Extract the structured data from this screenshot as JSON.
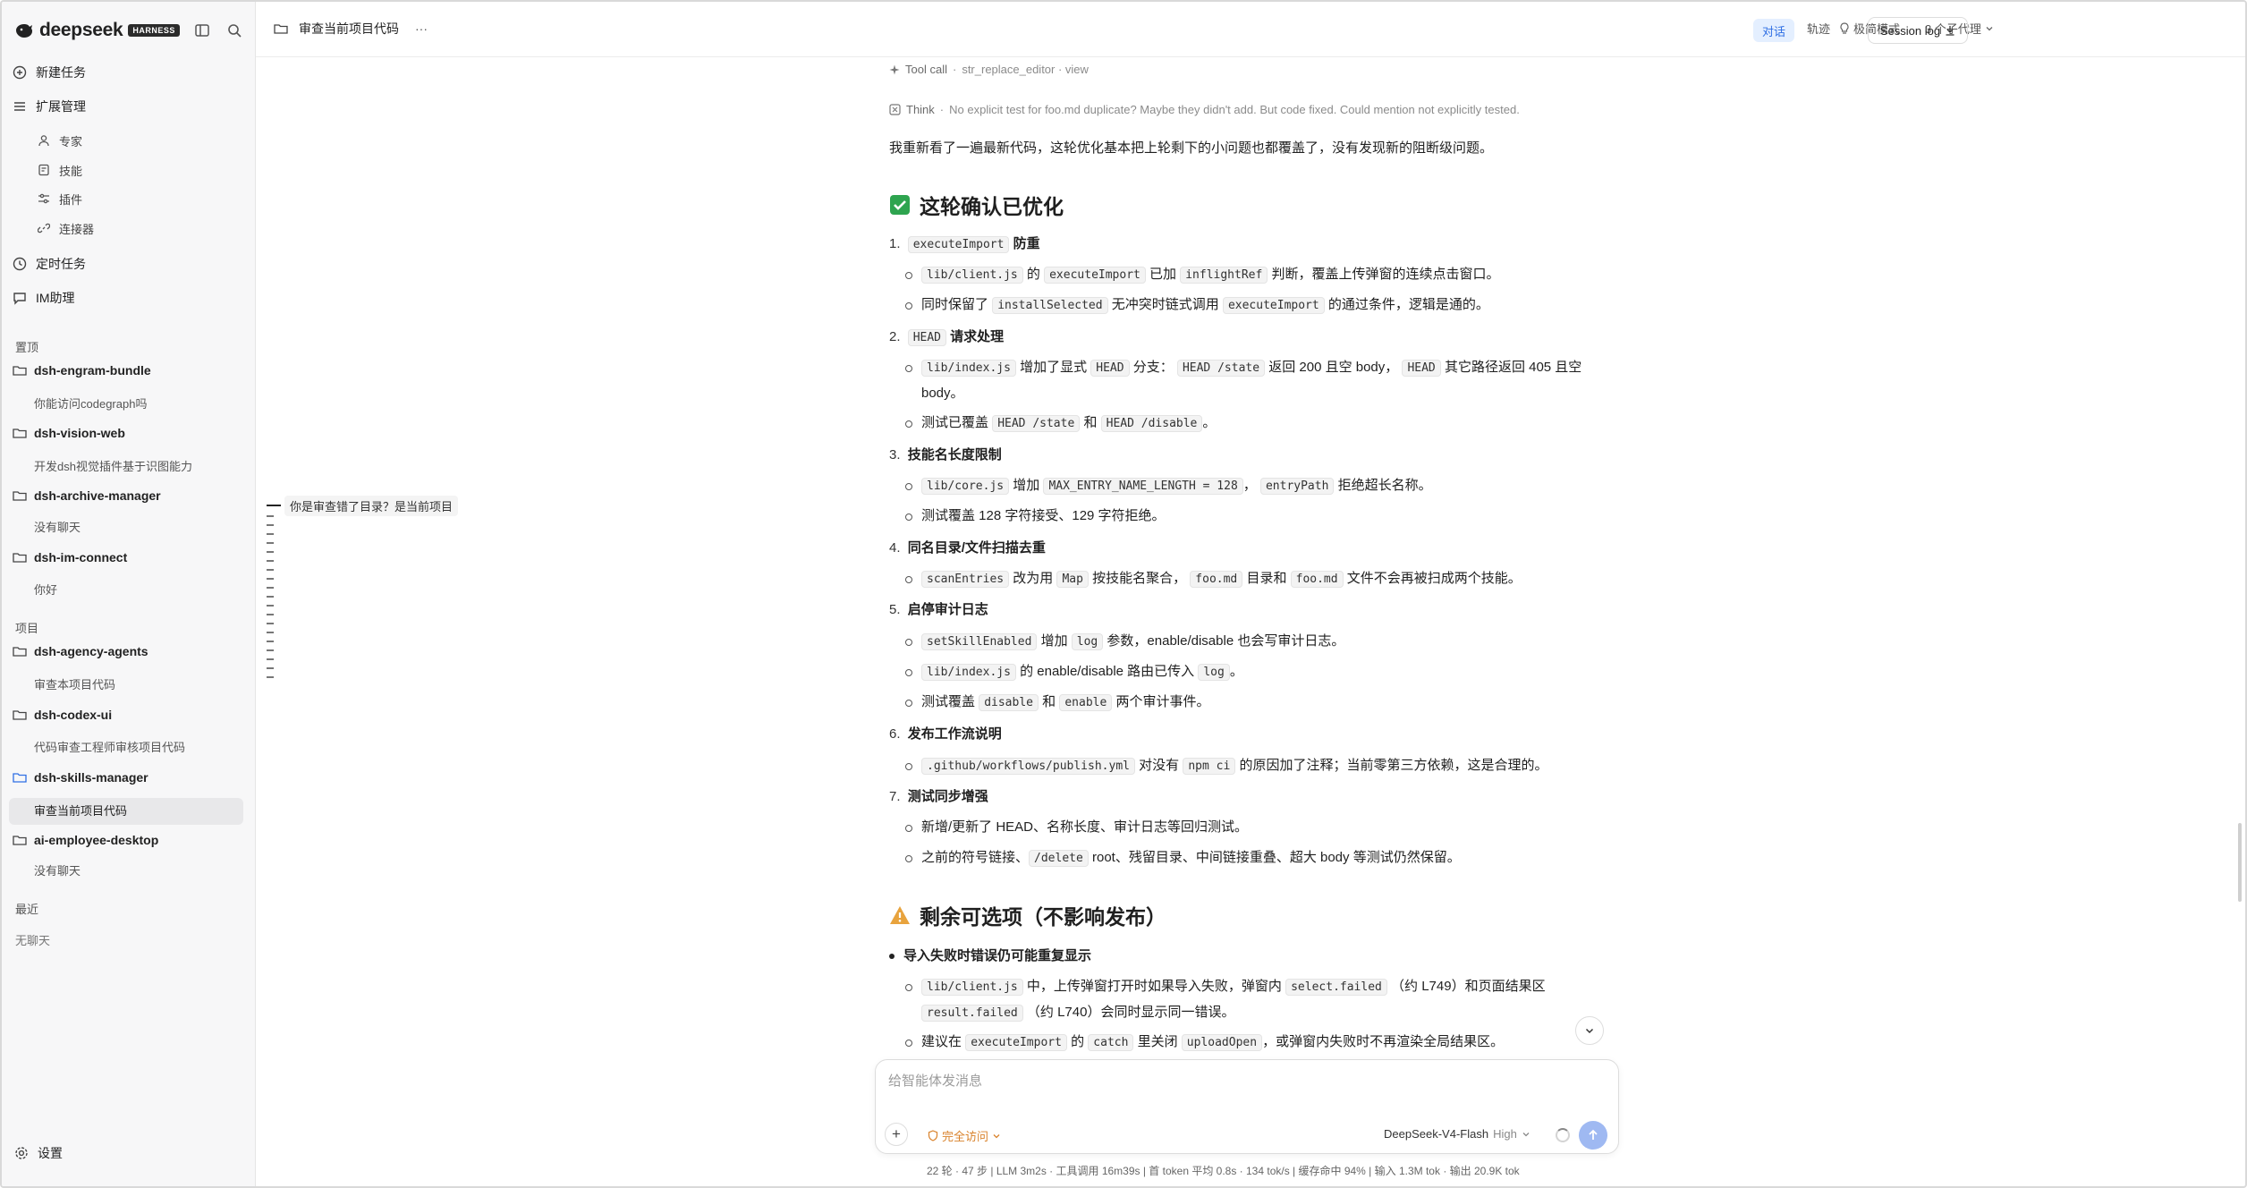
{
  "sidebar": {
    "brand": "deepseek",
    "badge": "HARNESS",
    "new_task": "新建任务",
    "ext_manage": "扩展管理",
    "sub_items": [
      "专家",
      "技能",
      "插件",
      "连接器"
    ],
    "scheduled": "定时任务",
    "im": "IM助理",
    "pinned_label": "置顶",
    "pinned": [
      {
        "name": "dsh-engram-bundle",
        "chat": "你能访问codegraph吗"
      },
      {
        "name": "dsh-vision-web",
        "chat": "开发dsh视觉插件基于识图能力"
      },
      {
        "name": "dsh-archive-manager",
        "chat": "没有聊天"
      },
      {
        "name": "dsh-im-connect",
        "chat": "你好"
      }
    ],
    "projects_label": "项目",
    "projects": [
      {
        "name": "dsh-agency-agents",
        "chat": "审查本项目代码"
      },
      {
        "name": "dsh-codex-ui",
        "chat": "代码审查工程师审核项目代码"
      },
      {
        "name": "dsh-skills-manager",
        "chat": "审查当前项目代码"
      },
      {
        "name": "ai-employee-desktop",
        "chat": "没有聊天"
      }
    ],
    "recent_label": "最近",
    "recent_empty": "无聊天",
    "settings": "设置"
  },
  "header": {
    "title": "审查当前项目代码",
    "more": "···",
    "simple_mode": "极简模式",
    "subagents": "3 个子代理",
    "tab_chat": "对话",
    "tab_trace": "轨迹",
    "session_log": "Session log"
  },
  "timeline": {
    "tooltip": "你是审查错了目录？是当前项目"
  },
  "message": {
    "tool_call_label": "Tool call",
    "tool_call_detail": "str_replace_editor · view",
    "think_label": "Think",
    "think_text": "No explicit test for foo.md duplicate? Maybe they didn't add. But code fixed. Could mention not explicitly tested.",
    "intro": "我重新看了一遍最新代码，这轮优化基本把上轮剩下的小问题也都覆盖了，没有发现新的阻断级问题。",
    "h_confirmed": "这轮确认已优化",
    "item1_code": "executeImport",
    "item1_title": "防重",
    "s1a_c1": "lib/client.js",
    "s1a_t1": "的",
    "s1a_c2": "executeImport",
    "s1a_t2": "已加",
    "s1a_c3": "inflightRef",
    "s1a_t3": "判断，覆盖上传弹窗的连续点击窗口。",
    "s1b_t1": "同时保留了",
    "s1b_c1": "installSelected",
    "s1b_t2": "无冲突时链式调用",
    "s1b_c2": "executeImport",
    "s1b_t3": "的通过条件，逻辑是通的。",
    "item2_code": "HEAD",
    "item2_title": "请求处理",
    "s2a_c1": "lib/index.js",
    "s2a_t1": "增加了显式",
    "s2a_c2": "HEAD",
    "s2a_t2": "分支：",
    "s2a_c3": "HEAD /state",
    "s2a_t3": "返回 200 且空 body，",
    "s2a_c4": "HEAD",
    "s2a_t4": "其它路径返回 405 且空 body。",
    "s2b_t1": "测试已覆盖",
    "s2b_c1": "HEAD /state",
    "s2b_t2": "和",
    "s2b_c2": "HEAD /disable",
    "s2b_t3": "。",
    "item3_title": "技能名长度限制",
    "s3a_c1": "lib/core.js",
    "s3a_t1": "增加",
    "s3a_c2": "MAX_ENTRY_NAME_LENGTH = 128",
    "s3a_t2": "，",
    "s3a_c3": "entryPath",
    "s3a_t3": "拒绝超长名称。",
    "s3b_t1": "测试覆盖 128 字符接受、129 字符拒绝。",
    "item4_title": "同名目录/文件扫描去重",
    "s4a_c1": "scanEntries",
    "s4a_t1": "改为用",
    "s4a_c2": "Map",
    "s4a_t2": "按技能名聚合，",
    "s4a_c3": "foo.md",
    "s4a_t3": "目录和",
    "s4a_c4": "foo.md",
    "s4a_t4": "文件不会再被扫成两个技能。",
    "item5_title": "启停审计日志",
    "s5a_c1": "setSkillEnabled",
    "s5a_t1": "增加",
    "s5a_c2": "log",
    "s5a_t2": "参数，enable/disable 也会写审计日志。",
    "s5b_c1": "lib/index.js",
    "s5b_t1": "的 enable/disable 路由已传入",
    "s5b_c2": "log",
    "s5b_t2": "。",
    "s5c_t1": "测试覆盖",
    "s5c_c1": "disable",
    "s5c_t2": "和",
    "s5c_c2": "enable",
    "s5c_t3": "两个审计事件。",
    "item6_title": "发布工作流说明",
    "s6a_c1": ".github/workflows/publish.yml",
    "s6a_t1": "对没有",
    "s6a_c2": "npm ci",
    "s6a_t2": "的原因加了注释；当前零第三方依赖，这是合理的。",
    "item7_title": "测试同步增强",
    "s7a_t1": "新增/更新了 HEAD、名称长度、审计日志等回归测试。",
    "s7b_t1": "之前的符号链接、",
    "s7b_c1": "/delete",
    "s7b_t2": "root、残留目录、中间链接重叠、超大 body 等测试仍然保留。",
    "h_remaining": "剩余可选项（不影响发布）",
    "r1_title": "导入失败时错误仍可能重复显示",
    "r1a_c1": "lib/client.js",
    "r1a_t1": "中，上传弹窗打开时如果导入失败，弹窗内",
    "r1a_c2": "select.failed",
    "r1a_t2": "（约 L749）和页面结果区",
    "r1a_c3": "result.failed",
    "r1a_t3": "（约 L740）会同时显示同一错误。",
    "r1b_t1": "建议在",
    "r1b_c1": "executeImport",
    "r1b_t2": "的",
    "r1b_c2": "catch",
    "r1b_t3": "里关闭",
    "r1b_c3": "uploadOpen",
    "r1b_t4": "，或弹窗内失败时不再渲染全局结果区。"
  },
  "composer": {
    "placeholder": "给智能体发消息",
    "access": "完全访问",
    "model": "DeepSeek-V4-Flash",
    "level": "High"
  },
  "stats": "22 轮 · 47 步   |   LLM 3m2s · 工具调用 16m39s   |   首 token 平均 0.8s · 134 tok/s   |   缓存命中 94%   |   输入 1.3M tok · 输出 20.9K tok",
  "colors": {
    "accent": "#2f6fe4",
    "check": "#2ea44f",
    "warning": "#e8a33d",
    "access": "#d9822b"
  }
}
